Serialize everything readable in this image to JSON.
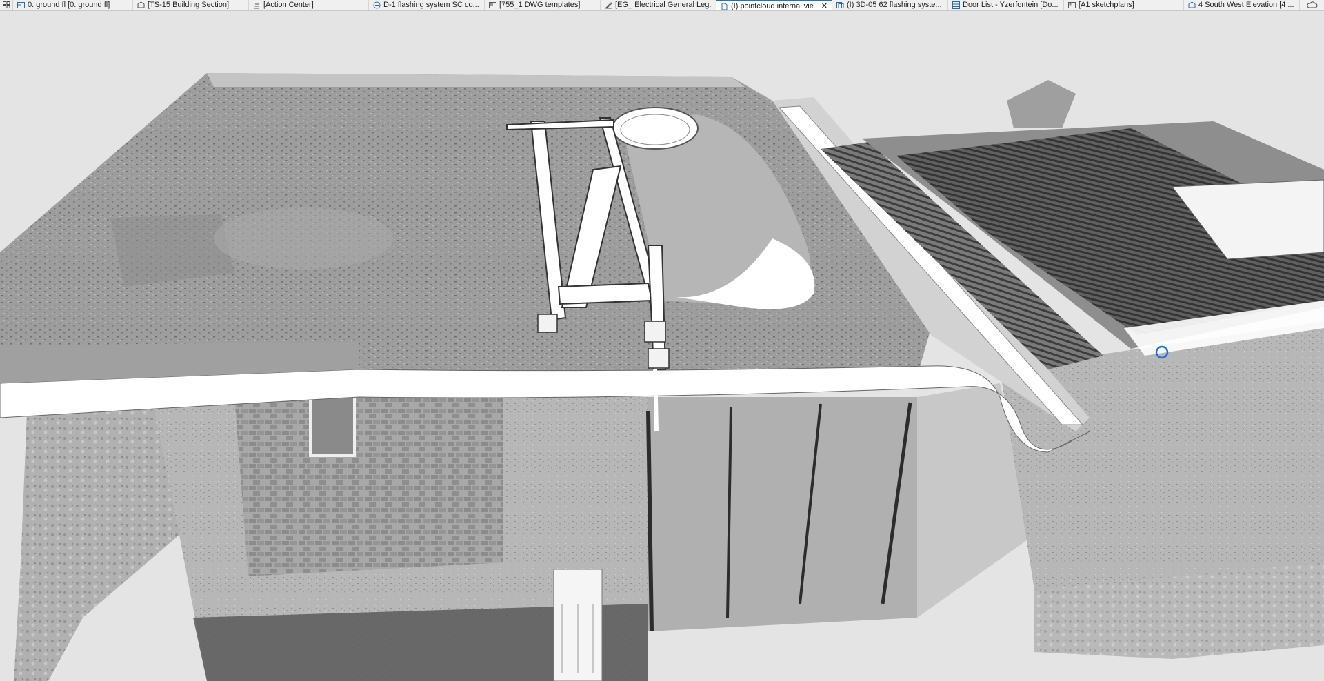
{
  "tabs": [
    {
      "label": "0. ground fl [0. ground fl]",
      "icon": "floor-plan-icon",
      "active": false
    },
    {
      "label": "[TS-15 Building Section]",
      "icon": "section-icon",
      "active": false
    },
    {
      "label": "[Action Center]",
      "icon": "action-center-icon",
      "active": false
    },
    {
      "label": "D-1 flashing system SC co...",
      "icon": "3d-detail-icon",
      "active": false
    },
    {
      "label": "[755_1 DWG templates]",
      "icon": "worksheet-icon",
      "active": false
    },
    {
      "label": "[EG_ Electrical General Leg...",
      "icon": "drawing-icon",
      "active": false
    },
    {
      "label": "(I) pointcloud internal vie...",
      "icon": "3d-document-icon",
      "active": true
    },
    {
      "label": "(I) 3D-05 62 flashing syste...",
      "icon": "3d-document-icon",
      "active": false
    },
    {
      "label": "Door List - Yzerfontein [Do...",
      "icon": "schedule-icon",
      "active": false
    },
    {
      "label": "[A1 sketchplans]",
      "icon": "layout-icon",
      "active": false
    },
    {
      "label": "4 South West Elevation [4 ...",
      "icon": "elevation-icon",
      "active": false
    }
  ],
  "active_tab_close": "✕",
  "colors": {
    "accent": "#1e6fd9",
    "tab_bg": "#f0f0f0",
    "viewport_bg": "#e4e4e4"
  }
}
